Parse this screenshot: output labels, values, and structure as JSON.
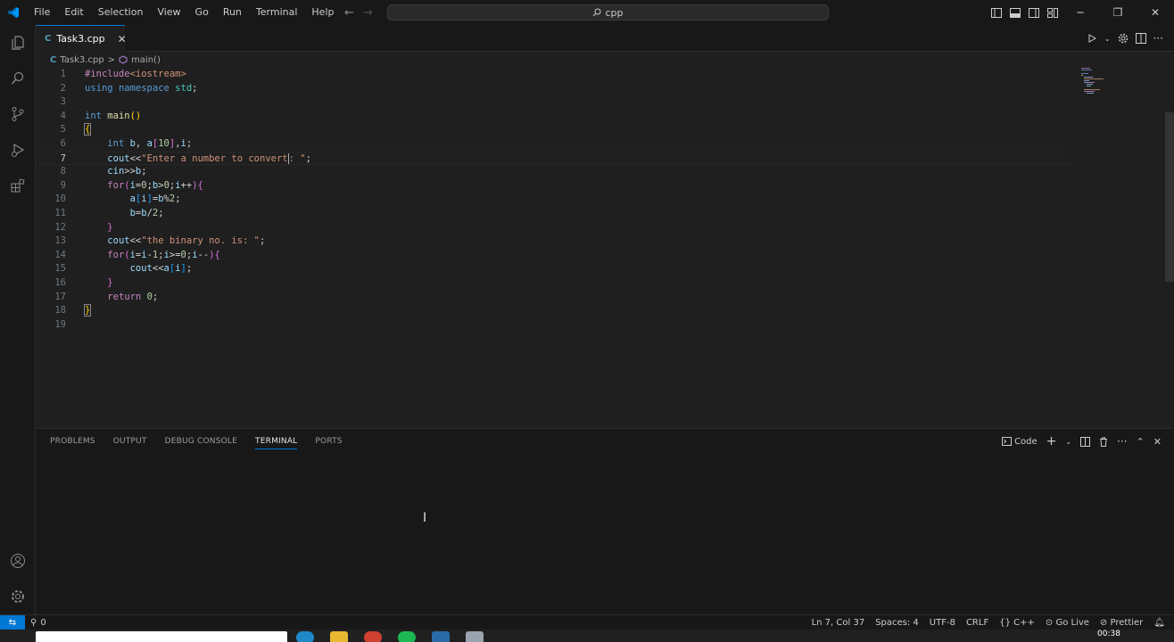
{
  "menu": [
    "File",
    "Edit",
    "Selection",
    "View",
    "Go",
    "Run",
    "Terminal",
    "Help"
  ],
  "search": {
    "text": "cpp"
  },
  "tab": {
    "label": "Task3.cpp",
    "icon": "C",
    "close": "✕"
  },
  "breadcrumb": {
    "file": "Task3.cpp",
    "sep": ">",
    "symbol": "main()"
  },
  "editor": {
    "line_numbers": [
      "1",
      "2",
      "3",
      "4",
      "5",
      "6",
      "7",
      "8",
      "9",
      "10",
      "11",
      "12",
      "13",
      "14",
      "15",
      "16",
      "17",
      "18",
      "19"
    ],
    "lines": [
      "#include<iostream>",
      "using namespace std;",
      "",
      "int main()",
      "{",
      "    int b, a[10],i;",
      "    cout<<\"Enter a number to convert: \";",
      "    cin>>b;",
      "    for(i=0;b>0;i++){",
      "        a[i]=b%2;",
      "        b=b/2;",
      "    }",
      "    cout<<\"the binary no. is: \";",
      "    for(i=i-1;i>=0;i--){",
      "        cout<<a[i];",
      "    }",
      "    return 0;",
      "}",
      ""
    ],
    "current_line": 7
  },
  "panel": {
    "tabs": [
      "PROBLEMS",
      "OUTPUT",
      "DEBUG CONSOLE",
      "TERMINAL",
      "PORTS"
    ],
    "active_tab": "TERMINAL",
    "terminal_name": "Code"
  },
  "status": {
    "problems": "0",
    "position": "Ln 7, Col 37",
    "spaces": "Spaces: 4",
    "encoding": "UTF-8",
    "eol": "CRLF",
    "language": "C++",
    "golive": "Go Live",
    "prettier": "Prettier"
  },
  "taskbar": {
    "time": "00:38"
  },
  "colors": {
    "accent": "#0078d4",
    "background": "#1f1f1f"
  }
}
